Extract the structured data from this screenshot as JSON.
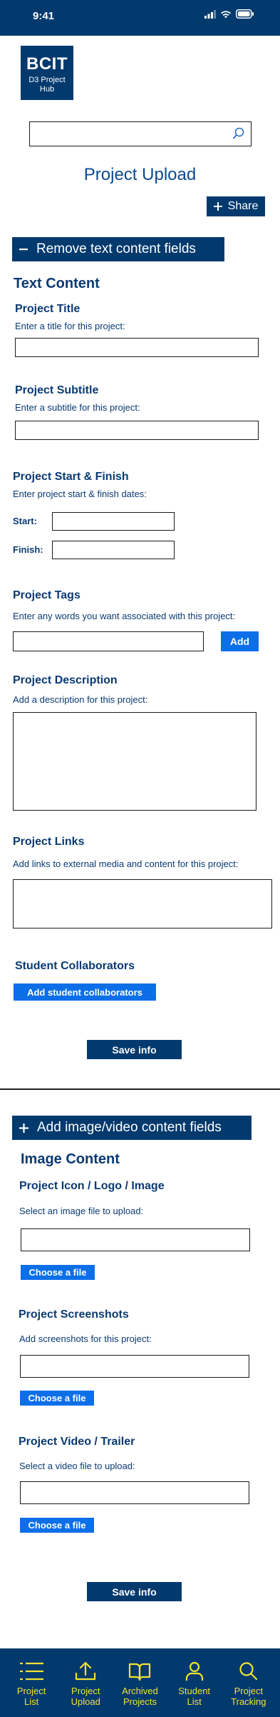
{
  "status_bar": {
    "time": "9:41"
  },
  "logo": {
    "title": "BCIT",
    "subtitle": "D3 Project Hub"
  },
  "search": {
    "placeholder": ""
  },
  "page": {
    "title": "Project Upload",
    "share_label": "Share"
  },
  "text_section": {
    "toggle_label": "Remove text content fields",
    "heading": "Text Content",
    "title_label": "Project Title",
    "title_help": "Enter a title for this project:",
    "subtitle_label": "Project Subtitle",
    "subtitle_help": "Enter a subtitle for this project:",
    "dates_label": "Project Start & Finish",
    "dates_help": "Enter project start & finish dates:",
    "start_label": "Start:",
    "finish_label": "Finish:",
    "tags_label": "Project Tags",
    "tags_help": "Enter any words you want associated with this project:",
    "add_label": "Add",
    "description_label": "Project Description",
    "description_help": "Add a description for this project:",
    "links_label": "Project Links",
    "links_help": "Add links to external media and content for this project:",
    "collaborators_label": "Student Collaborators",
    "add_collaborators_label": "Add student collaborators",
    "save_label": "Save info"
  },
  "media_section": {
    "toggle_label": "Add image/video content fields",
    "heading": "Image Content",
    "icon_label": "Project Icon / Logo / Image",
    "icon_help": "Select an image file to upload:",
    "screenshots_label": "Project Screenshots",
    "screenshots_help": "Add screenshots for this project:",
    "video_label": "Project Video / Trailer",
    "video_help": "Select a video file to upload:",
    "choose_file_label": "Choose a file",
    "save_label": "Save info"
  },
  "bottom_nav": {
    "items": [
      {
        "label_1": "Project",
        "label_2": "List",
        "icon": "list-icon"
      },
      {
        "label_1": "Project",
        "label_2": "Upload",
        "icon": "upload-icon"
      },
      {
        "label_1": "Archived",
        "label_2": "Projects",
        "icon": "book-icon"
      },
      {
        "label_1": "Student",
        "label_2": "List",
        "icon": "person-icon"
      },
      {
        "label_1": "Project",
        "label_2": "Tracking",
        "icon": "search-icon"
      }
    ]
  },
  "colors": {
    "primary": "#033a6e",
    "accent": "#0d6fe8",
    "nav_text": "#f2e233"
  }
}
